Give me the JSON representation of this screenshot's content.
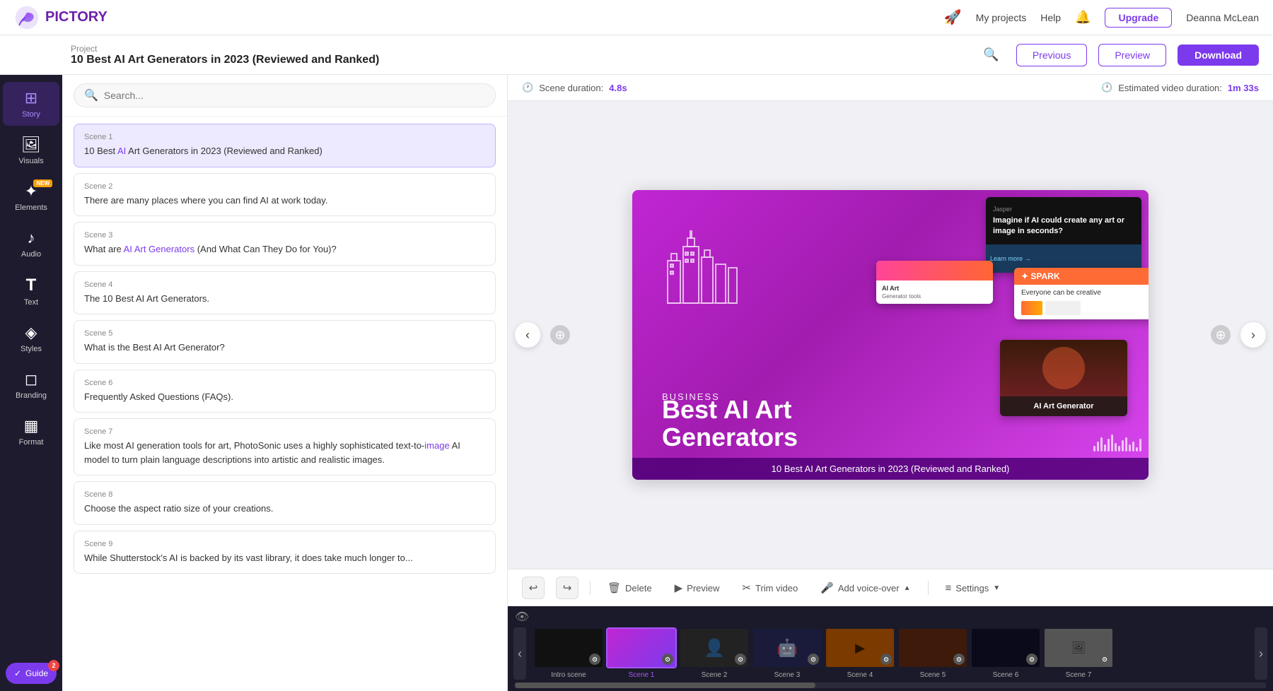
{
  "app": {
    "name": "PICTORY",
    "logo_aria": "Pictory logo"
  },
  "nav": {
    "my_projects": "My projects",
    "help": "Help",
    "upgrade": "Upgrade",
    "user": "Deanna McLean"
  },
  "header": {
    "project_label": "Project",
    "project_title": "10 Best AI Art Generators in 2023 (Reviewed and Ranked)",
    "previous_btn": "Previous",
    "preview_btn": "Preview",
    "download_btn": "Download"
  },
  "duration": {
    "scene_label": "Scene duration:",
    "scene_value": "4.8s",
    "estimated_label": "Estimated video duration:",
    "estimated_value": "1m 33s"
  },
  "sidebar": {
    "items": [
      {
        "id": "story",
        "icon": "⊞",
        "label": "Story",
        "active": true
      },
      {
        "id": "visuals",
        "icon": "🖼",
        "label": "Visuals",
        "active": false
      },
      {
        "id": "elements",
        "icon": "✦",
        "label": "Elements",
        "active": false,
        "badge": "NEW"
      },
      {
        "id": "audio",
        "icon": "♪",
        "label": "Audio",
        "active": false
      },
      {
        "id": "text",
        "icon": "T",
        "label": "Text",
        "active": false
      },
      {
        "id": "styles",
        "icon": "◈",
        "label": "Styles",
        "active": false
      },
      {
        "id": "branding",
        "icon": "◻",
        "label": "Branding",
        "active": false
      },
      {
        "id": "format",
        "icon": "▦",
        "label": "Format",
        "active": false
      }
    ],
    "guide_btn": "Guide",
    "guide_badge": "2"
  },
  "search": {
    "placeholder": "Search..."
  },
  "scenes": [
    {
      "id": 1,
      "label": "Scene 1",
      "text": "10 Best AI Art Generators in 2023 (Reviewed and Ranked)",
      "highlights": [],
      "active": true
    },
    {
      "id": 2,
      "label": "Scene 2",
      "text": "There are many places where you can find AI at work today.",
      "highlights": []
    },
    {
      "id": 3,
      "label": "Scene 3",
      "text": "What are AI Art Generators (And What Can They Do for You)?",
      "highlights": [
        "AI Art Generators"
      ]
    },
    {
      "id": 4,
      "label": "Scene 4",
      "text": "The 10 Best AI Art Generators.",
      "highlights": []
    },
    {
      "id": 5,
      "label": "Scene 5",
      "text": "What is the Best AI Art Generator?",
      "highlights": []
    },
    {
      "id": 6,
      "label": "Scene 6",
      "text": "Frequently Asked Questions (FAQs).",
      "highlights": []
    },
    {
      "id": 7,
      "label": "Scene 7",
      "text": "Like most AI generation tools for art, PhotoSonic uses a highly sophisticated text-to-image AI model to turn plain language descriptions into artistic and realistic images.",
      "highlights": [
        "image"
      ]
    },
    {
      "id": 8,
      "label": "Scene 8",
      "text": "Choose the aspect ratio size of your creations.",
      "highlights": []
    },
    {
      "id": 9,
      "label": "Scene 9",
      "text": "While Shutterstock's AI is backed by its vast library, it does take much longer to...",
      "highlights": []
    }
  ],
  "preview": {
    "business_label": "BUSINESS",
    "main_title_line1": "Best AI Art",
    "main_title_line2": "Generators",
    "caption": "10 Best AI Art Generators in 2023 (Reviewed and Ranked)",
    "screenshot1_text": "Imagine if AI could create any art or image in seconds?",
    "screenshot2_logo": "✦ SPARK",
    "screenshot2_tagline": "Everyone can be creative",
    "screenshot3_label": "AI Art Generator",
    "ai_art_generator_label": "AI Art Generator"
  },
  "controls": {
    "undo": "↩",
    "redo": "↪",
    "delete": "Delete",
    "preview": "Preview",
    "trim_video": "Trim video",
    "add_voiceover": "Add voice-over",
    "settings": "Settings"
  },
  "timeline": {
    "scenes": [
      {
        "label": "Intro scene",
        "bg": "dark",
        "active": false
      },
      {
        "label": "Scene 1",
        "bg": "purple",
        "active": true
      },
      {
        "label": "Scene 2",
        "bg": "dark2",
        "active": false
      },
      {
        "label": "Scene 3",
        "bg": "blue-dark",
        "active": false
      },
      {
        "label": "Scene 4",
        "bg": "orange",
        "active": false
      },
      {
        "label": "Scene 5",
        "bg": "brown",
        "active": false
      },
      {
        "label": "Scene 6",
        "bg": "dark3",
        "active": false
      },
      {
        "label": "Scene 7",
        "bg": "gray",
        "active": false
      }
    ]
  }
}
